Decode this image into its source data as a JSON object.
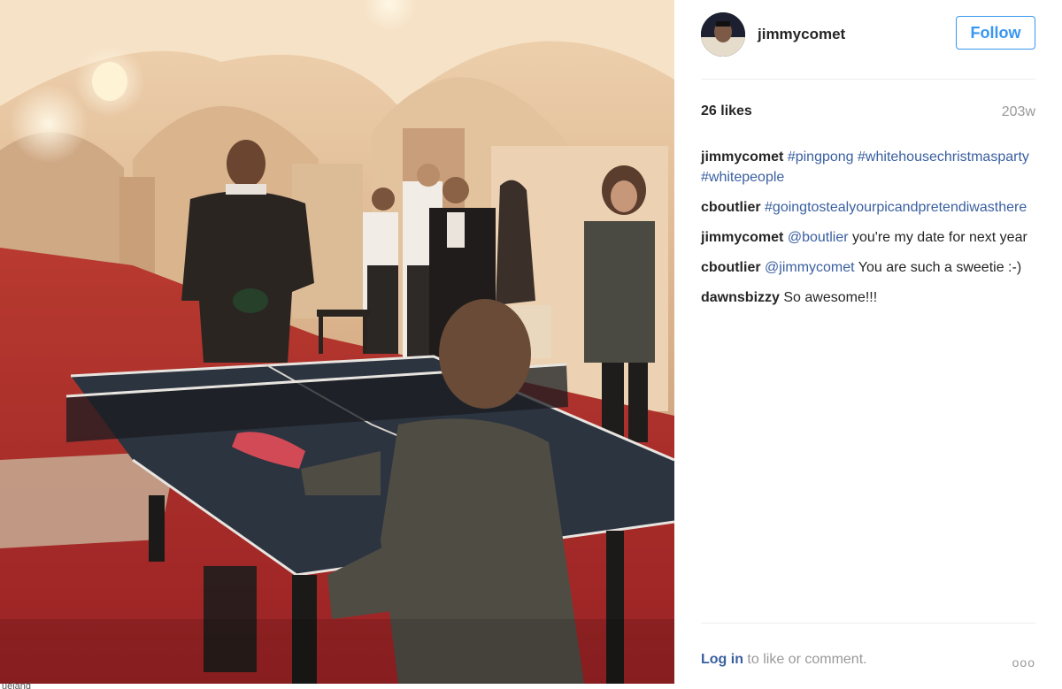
{
  "post": {
    "username": "jimmycomet",
    "follow_label": "Follow",
    "likes": "26 likes",
    "age": "203w",
    "comments": [
      {
        "author": "jimmycomet",
        "parts": [
          {
            "text": "#pingpong",
            "tag": true
          },
          {
            "text": " "
          },
          {
            "text": "#whitehousechristmasparty",
            "tag": true
          },
          {
            "text": " "
          },
          {
            "text": "#whitepeople",
            "tag": true
          }
        ]
      },
      {
        "author": "cboutlier",
        "parts": [
          {
            "text": "#goingtostealyourpicandpretendiwasthere",
            "tag": true
          }
        ]
      },
      {
        "author": "jimmycomet",
        "parts": [
          {
            "text": "@boutlier",
            "tag": true
          },
          {
            "text": " you're my date for next year"
          }
        ]
      },
      {
        "author": "cboutlier",
        "parts": [
          {
            "text": "@jimmycomet",
            "tag": true
          },
          {
            "text": " You are such a sweetie :-)"
          }
        ]
      },
      {
        "author": "dawnsbizzy",
        "parts": [
          {
            "text": "So awesome!!!"
          }
        ]
      }
    ],
    "footer": {
      "login": "Log in",
      "rest": " to like or comment.",
      "more": "ooo"
    },
    "photo_caption_fragment": "ueland"
  },
  "colors": {
    "follow_blue": "#3897f0",
    "link_blue": "#3a5fa0",
    "carpet_red": "#a8282a",
    "table_blue": "#2c3440"
  },
  "icons": {
    "avatar": "profile-avatar",
    "more": "ellipsis-icon"
  }
}
